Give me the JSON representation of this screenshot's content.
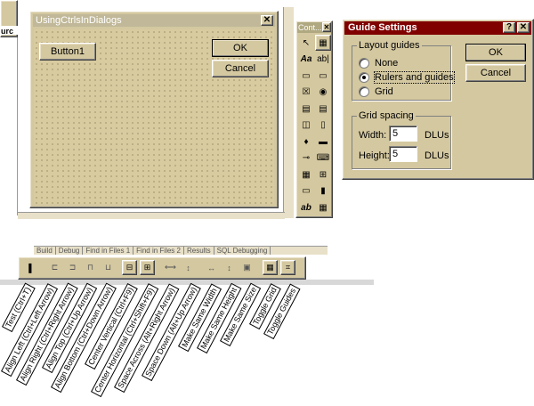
{
  "left_panel": {
    "truncated_label": "urc"
  },
  "dialog": {
    "title": "UsingCtrlsInDialogs",
    "close": "✕",
    "button1_label": "Button1",
    "ok_label": "OK",
    "cancel_label": "Cancel"
  },
  "controls_palette": {
    "title": "Cont...",
    "close": "✕",
    "tools": [
      {
        "icon": "pointer-icon",
        "glyph": "↖"
      },
      {
        "icon": "picture-icon",
        "glyph": "▦"
      },
      {
        "icon": "static-text-icon",
        "glyph": "Aa"
      },
      {
        "icon": "edit-box-icon",
        "glyph": "ab|"
      },
      {
        "icon": "group-box-icon",
        "glyph": "▭"
      },
      {
        "icon": "button-icon",
        "glyph": "▭"
      },
      {
        "icon": "checkbox-icon",
        "glyph": "☒"
      },
      {
        "icon": "radio-icon",
        "glyph": "◉"
      },
      {
        "icon": "combo-box-icon",
        "glyph": "▤"
      },
      {
        "icon": "list-box-icon",
        "glyph": "▤"
      },
      {
        "icon": "h-scroll-icon",
        "glyph": "◫"
      },
      {
        "icon": "v-scroll-icon",
        "glyph": "▯"
      },
      {
        "icon": "spin-icon",
        "glyph": "♦"
      },
      {
        "icon": "progress-icon",
        "glyph": "▬"
      },
      {
        "icon": "slider-icon",
        "glyph": "⊸"
      },
      {
        "icon": "hotkey-icon",
        "glyph": "⌨"
      },
      {
        "icon": "list-control-icon",
        "glyph": "▦"
      },
      {
        "icon": "tree-control-icon",
        "glyph": "⊞"
      },
      {
        "icon": "tab-control-icon",
        "glyph": "▭"
      },
      {
        "icon": "animate-icon",
        "glyph": "▮"
      },
      {
        "icon": "rich-edit-icon",
        "glyph": "ab"
      },
      {
        "icon": "date-picker-icon",
        "glyph": "▦"
      }
    ]
  },
  "guide_settings": {
    "title": "Guide Settings",
    "help": "?",
    "close": "✕",
    "layout_group_label": "Layout guides",
    "radio_none": "None",
    "radio_rulers": "Rulers and guides",
    "radio_grid": "Grid",
    "selected": "Rulers and guides",
    "spacing_group_label": "Grid spacing",
    "width_label": "Width:",
    "width_value": "5",
    "height_label": "Height:",
    "height_value": "5",
    "unit": "DLUs",
    "ok_label": "OK",
    "cancel_label": "Cancel"
  },
  "output_tabs": [
    "Build",
    "Debug",
    "Find in Files 1",
    "Find in Files 2",
    "Results",
    "SQL Debugging"
  ],
  "layout_toolbar": {
    "labels": [
      "Test (Ctrl+T)",
      "Align Left (Ctrl+Left Arrow)",
      "Align Right (Ctrl+Right Arrow)",
      "Align Top (Ctrl+Up Arrow)",
      "Align Bottom (Ctrl+Down Arrow)",
      "Center Vertical (Ctrl+F9)",
      "Center Horizontal (Ctrl+Shift+F9)",
      "Space Across (Alt+Right Arrow)",
      "Space Down (Alt+Up Arrow)",
      "Make Same Width",
      "Make Same Height",
      "Make Same Size",
      "Toggle Grid",
      "Toggle Guides"
    ]
  }
}
